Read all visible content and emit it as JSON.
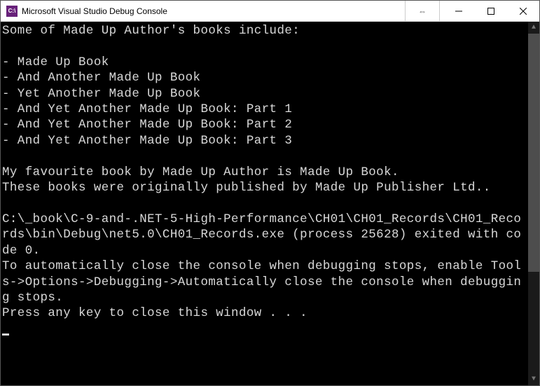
{
  "window": {
    "title": "Microsoft Visual Studio Debug Console",
    "icon_text": "C:\\"
  },
  "console": {
    "intro_line": "Some of Made Up Author's books include:",
    "book_list": [
      "Made Up Book",
      "And Another Made Up Book",
      "Yet Another Made Up Book",
      "And Yet Another Made Up Book: Part 1",
      "And Yet Another Made Up Book: Part 2",
      "And Yet Another Made Up Book: Part 3"
    ],
    "favourite_line": "My favourite book by Made Up Author is Made Up Book.",
    "publisher_line": "These books were originally published by Made Up Publisher Ltd..",
    "exit_line": "C:\\_book\\C-9-and-.NET-5-High-Performance\\CH01\\CH01_Records\\CH01_Records\\bin\\Debug\\net5.0\\CH01_Records.exe (process 25628) exited with code 0.",
    "auto_close_line": "To automatically close the console when debugging stops, enable Tools->Options->Debugging->Automatically close the console when debugging stops.",
    "press_key_line": "Press any key to close this window . . . "
  },
  "drag_handle_glyph": "⇔"
}
